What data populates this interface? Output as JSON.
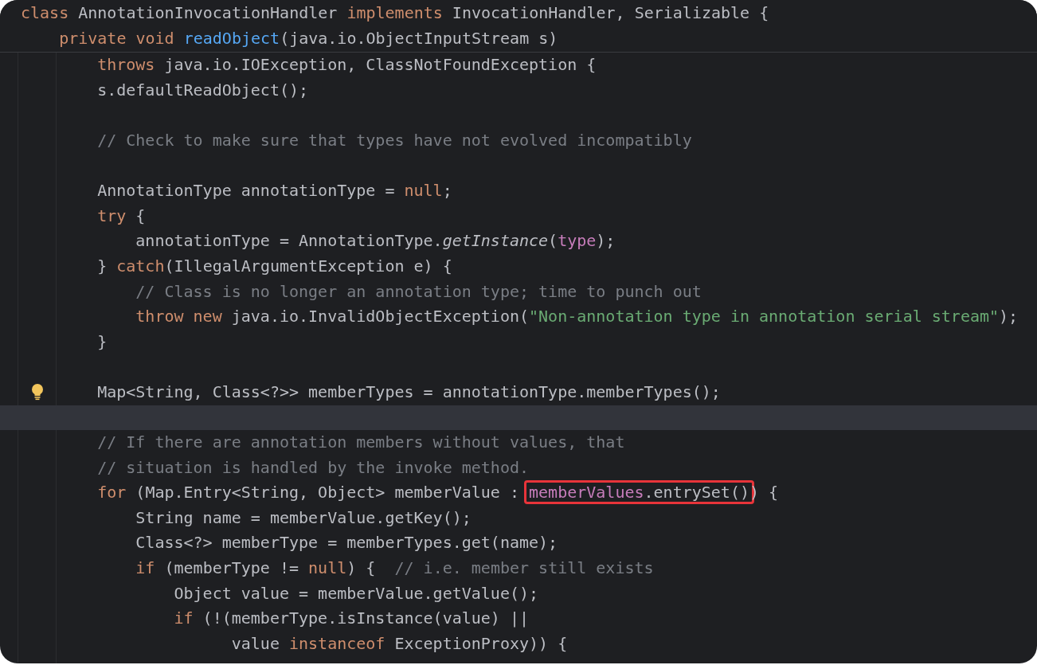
{
  "sticky_header": [
    {
      "tokens": [
        {
          "kind": "kw",
          "text": "class "
        },
        {
          "kind": "plain",
          "text": "AnnotationInvocationHandler "
        },
        {
          "kind": "kw",
          "text": "implements "
        },
        {
          "kind": "plain",
          "text": "InvocationHandler, Serializable {"
        }
      ]
    },
    {
      "tokens": [
        {
          "kind": "kw",
          "text": "    private void "
        },
        {
          "kind": "fn",
          "text": "readObject"
        },
        {
          "kind": "plain",
          "text": "(java.io.ObjectInputStream s)"
        }
      ]
    }
  ],
  "lines": [
    {
      "current": false,
      "hint": false,
      "tokens": [
        {
          "kind": "kw",
          "text": "    throws "
        },
        {
          "kind": "plain",
          "text": "java.io.IOException, ClassNotFoundException {"
        }
      ]
    },
    {
      "current": false,
      "hint": false,
      "tokens": [
        {
          "kind": "plain",
          "text": "    s.defaultReadObject();"
        }
      ]
    },
    {
      "current": false,
      "hint": false
    },
    {
      "current": false,
      "hint": false,
      "tokens": [
        {
          "kind": "comment",
          "text": "    // Check to make sure that types have not evolved incompatibly"
        }
      ]
    },
    {
      "current": false,
      "hint": false
    },
    {
      "current": false,
      "hint": false,
      "tokens": [
        {
          "kind": "plain",
          "text": "    AnnotationType annotationType = "
        },
        {
          "kind": "kw",
          "text": "null"
        },
        {
          "kind": "plain",
          "text": ";"
        }
      ]
    },
    {
      "current": false,
      "hint": false,
      "tokens": [
        {
          "kind": "kw",
          "text": "    try"
        },
        {
          "kind": "plain",
          "text": " {"
        }
      ]
    },
    {
      "current": false,
      "hint": false,
      "tokens": [
        {
          "kind": "plain",
          "text": "        annotationType = AnnotationType."
        },
        {
          "kind": "italic",
          "text": "getInstance"
        },
        {
          "kind": "plain",
          "text": "("
        },
        {
          "kind": "field",
          "text": "type"
        },
        {
          "kind": "plain",
          "text": ");"
        }
      ]
    },
    {
      "current": false,
      "hint": false,
      "tokens": [
        {
          "kind": "plain",
          "text": "    } "
        },
        {
          "kind": "kw",
          "text": "catch"
        },
        {
          "kind": "plain",
          "text": "(IllegalArgumentException e) {"
        }
      ]
    },
    {
      "current": false,
      "hint": false,
      "tokens": [
        {
          "kind": "comment",
          "text": "        // Class is no longer an annotation type; time to punch out"
        }
      ]
    },
    {
      "current": false,
      "hint": false,
      "tokens": [
        {
          "kind": "kw",
          "text": "        throw new "
        },
        {
          "kind": "plain",
          "text": "java.io.InvalidObjectException("
        },
        {
          "kind": "str",
          "text": "\"Non-annotation type in annotation serial stream\""
        },
        {
          "kind": "plain",
          "text": ");"
        }
      ]
    },
    {
      "current": false,
      "hint": false,
      "tokens": [
        {
          "kind": "plain",
          "text": "    }"
        }
      ]
    },
    {
      "current": false,
      "hint": false
    },
    {
      "current": false,
      "hint": true,
      "tokens": [
        {
          "kind": "plain",
          "text": "    Map<String, Class<?>> memberTypes = annotationType.memberTypes();"
        }
      ]
    },
    {
      "current": true,
      "hint": false
    },
    {
      "current": false,
      "hint": false,
      "tokens": [
        {
          "kind": "comment",
          "text": "    // If there are annotation members without values, that"
        }
      ]
    },
    {
      "current": false,
      "hint": false,
      "tokens": [
        {
          "kind": "comment",
          "text": "    // situation is handled by the invoke method."
        }
      ]
    },
    {
      "current": false,
      "hint": false,
      "tokens": [
        {
          "kind": "kw",
          "text": "    for"
        },
        {
          "kind": "plain",
          "text": " (Map.Entry<String, Object> memberValue : "
        },
        {
          "kind": "box",
          "tokens": [
            {
              "kind": "field",
              "text": "memberValues"
            },
            {
              "kind": "plain",
              "text": ".entrySet()"
            }
          ]
        },
        {
          "kind": "plain",
          "text": ") {"
        }
      ]
    },
    {
      "current": false,
      "hint": false,
      "tokens": [
        {
          "kind": "plain",
          "text": "        String name = memberValue.getKey();"
        }
      ]
    },
    {
      "current": false,
      "hint": false,
      "tokens": [
        {
          "kind": "plain",
          "text": "        Class<?> memberType = memberTypes.get(name);"
        }
      ]
    },
    {
      "current": false,
      "hint": false,
      "tokens": [
        {
          "kind": "kw",
          "text": "        if"
        },
        {
          "kind": "plain",
          "text": " (memberType != "
        },
        {
          "kind": "kw",
          "text": "null"
        },
        {
          "kind": "plain",
          "text": ") {  "
        },
        {
          "kind": "comment",
          "text": "// i.e. member still exists"
        }
      ]
    },
    {
      "current": false,
      "hint": false,
      "tokens": [
        {
          "kind": "plain",
          "text": "            Object value = memberValue.getValue();"
        }
      ]
    },
    {
      "current": false,
      "hint": false,
      "tokens": [
        {
          "kind": "kw",
          "text": "            if"
        },
        {
          "kind": "plain",
          "text": " (!(memberType.isInstance(value) ||"
        }
      ]
    },
    {
      "current": false,
      "hint": false,
      "tokens": [
        {
          "kind": "plain",
          "text": "                  value "
        },
        {
          "kind": "kw",
          "text": "instanceof"
        },
        {
          "kind": "plain",
          "text": " ExceptionProxy)) {"
        }
      ]
    }
  ]
}
